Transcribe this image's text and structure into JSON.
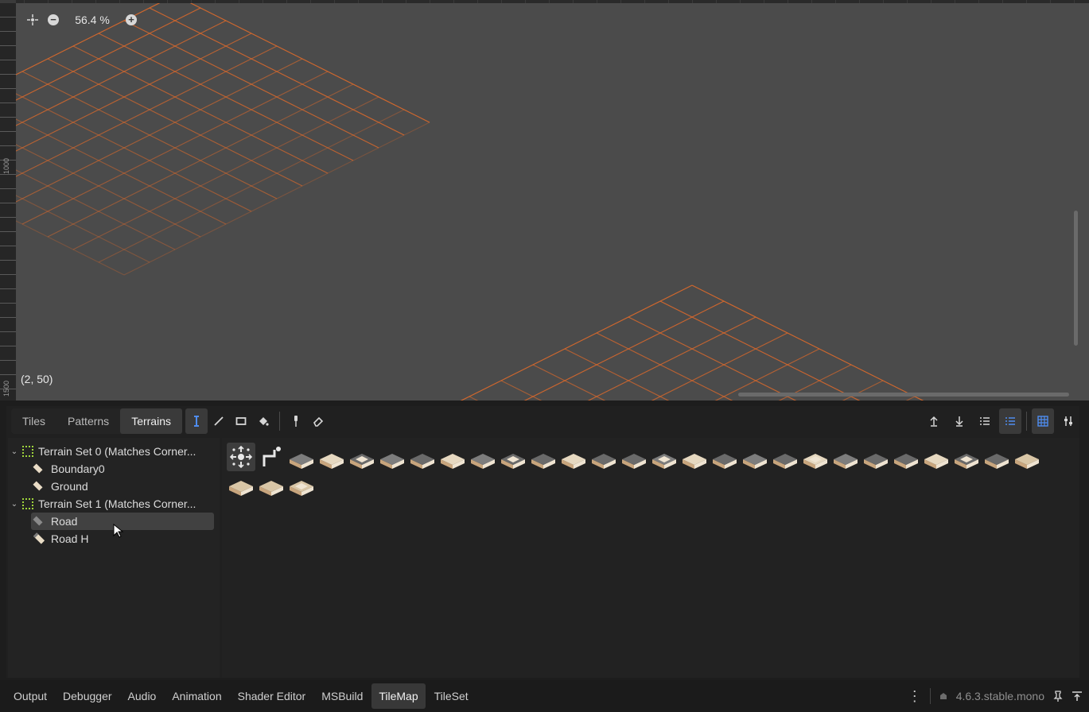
{
  "viewport": {
    "zoom_text": "56.4 %",
    "cursor_coord": "(2, 50)",
    "ruler_labels": [
      "1000",
      "1500"
    ],
    "grid_color": "#e06a2a"
  },
  "panel": {
    "tabs": [
      {
        "label": "Tiles",
        "active": false
      },
      {
        "label": "Patterns",
        "active": false
      },
      {
        "label": "Terrains",
        "active": true
      }
    ],
    "tree": [
      {
        "type": "set",
        "label": "Terrain Set 0 (Matches Corner..."
      },
      {
        "type": "terrain",
        "label": "Boundary0",
        "icon": "tile"
      },
      {
        "type": "terrain",
        "label": "Ground",
        "icon": "tile"
      },
      {
        "type": "set",
        "label": "Terrain Set 1 (Matches Corner..."
      },
      {
        "type": "terrain",
        "label": "Road",
        "icon": "grey",
        "selected": true
      },
      {
        "type": "terrain",
        "label": "Road H",
        "icon": "road"
      }
    ],
    "tile_count": 28
  },
  "bottombar": {
    "tabs": [
      "Output",
      "Debugger",
      "Audio",
      "Animation",
      "Shader Editor",
      "MSBuild",
      "TileMap",
      "TileSet"
    ],
    "active_tab": "TileMap",
    "version": "4.6.3.stable.mono"
  },
  "colors": {
    "accent": "#4f8df0",
    "terrain_set_icon": "#9fd53b"
  }
}
